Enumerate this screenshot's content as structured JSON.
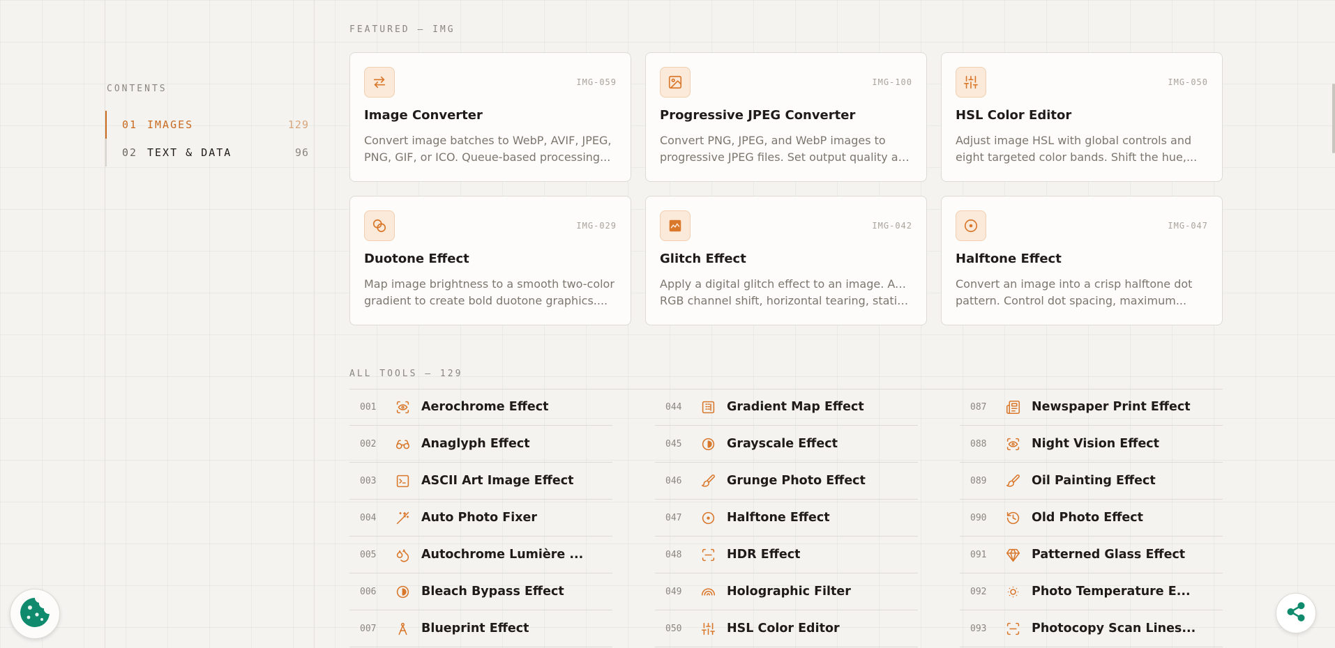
{
  "sidebar": {
    "heading": "CONTENTS",
    "items": [
      {
        "num": "01",
        "label": "IMAGES",
        "count": "129",
        "active": true
      },
      {
        "num": "02",
        "label": "TEXT & DATA",
        "count": "96",
        "active": false
      }
    ]
  },
  "featured": {
    "heading": "FEATURED — IMG",
    "cards": [
      {
        "code": "IMG-059",
        "title": "Image Converter",
        "icon": "convert-arrows-icon",
        "desc1": "Convert image batches to WebP, AVIF, JPEG,",
        "desc2": "PNG, GIF, or ICO. Queue-based processing..."
      },
      {
        "code": "IMG-100",
        "title": "Progressive JPEG Converter",
        "icon": "image-icon",
        "desc1": "Convert PNG, JPEG, and WebP images to",
        "desc2": "progressive JPEG files. Set output quality an..."
      },
      {
        "code": "IMG-050",
        "title": "HSL Color Editor",
        "icon": "sliders-icon",
        "desc1": "Adjust image HSL with global controls and",
        "desc2": "eight targeted color bands. Shift the hue,..."
      },
      {
        "code": "IMG-029",
        "title": "Duotone Effect",
        "icon": "overlapping-circles-icon",
        "desc1": "Map image brightness to a smooth two-color",
        "desc2": "gradient to create bold duotone graphics...."
      },
      {
        "code": "IMG-042",
        "title": "Glitch Effect",
        "icon": "glitch-image-icon",
        "desc1": "Apply a digital glitch effect to an image. Adjust",
        "desc2": "RGB channel shift, horizontal tearing, static..."
      },
      {
        "code": "IMG-047",
        "title": "Halftone Effect",
        "icon": "circle-dot-icon",
        "desc1": "Convert an image into a crisp halftone dot",
        "desc2": "pattern. Control dot spacing, maximum..."
      }
    ]
  },
  "all_tools": {
    "heading": "ALL TOOLS — 129",
    "columns": [
      [
        {
          "num": "001",
          "name": "Aerochrome Effect",
          "icon": "eye-scan-icon"
        },
        {
          "num": "002",
          "name": "Anaglyph Effect",
          "icon": "glasses-icon"
        },
        {
          "num": "003",
          "name": "ASCII Art Image Effect",
          "icon": "terminal-square-icon"
        },
        {
          "num": "004",
          "name": "Auto Photo Fixer",
          "icon": "magic-wand-icon"
        },
        {
          "num": "005",
          "name": "Autochrome Lumière ...",
          "icon": "droplets-icon"
        },
        {
          "num": "006",
          "name": "Bleach Bypass Effect",
          "icon": "contrast-circle-icon"
        },
        {
          "num": "007",
          "name": "Blueprint Effect",
          "icon": "compass-drafting-icon"
        }
      ],
      [
        {
          "num": "044",
          "name": "Gradient Map Effect",
          "icon": "gradient-square-icon"
        },
        {
          "num": "045",
          "name": "Grayscale Effect",
          "icon": "contrast-circle-icon"
        },
        {
          "num": "046",
          "name": "Grunge Photo Effect",
          "icon": "brush-icon"
        },
        {
          "num": "047",
          "name": "Halftone Effect",
          "icon": "circle-dot-icon"
        },
        {
          "num": "048",
          "name": "HDR Effect",
          "icon": "scan-frame-icon"
        },
        {
          "num": "049",
          "name": "Holographic Filter",
          "icon": "rainbow-icon"
        },
        {
          "num": "050",
          "name": "HSL Color Editor",
          "icon": "sliders-icon"
        }
      ],
      [
        {
          "num": "087",
          "name": "Newspaper Print Effect",
          "icon": "newspaper-icon"
        },
        {
          "num": "088",
          "name": "Night Vision Effect",
          "icon": "eye-scan-icon"
        },
        {
          "num": "089",
          "name": "Oil Painting Effect",
          "icon": "brush-icon"
        },
        {
          "num": "090",
          "name": "Old Photo Effect",
          "icon": "history-icon"
        },
        {
          "num": "091",
          "name": "Patterned Glass Effect",
          "icon": "gem-icon"
        },
        {
          "num": "092",
          "name": "Photo Temperature E...",
          "icon": "sun-dim-icon"
        },
        {
          "num": "093",
          "name": "Photocopy Scan Lines...",
          "icon": "scan-frame-icon"
        }
      ]
    ]
  },
  "floating": {
    "cookie_icon": "cookie-icon",
    "share_icon": "share-icon"
  },
  "colors": {
    "accent": "#c96a1f",
    "background": "#f4f3f0",
    "card": "#fdfcfa",
    "cookie": "#0f8a6c",
    "share": "#0f8a6c"
  }
}
